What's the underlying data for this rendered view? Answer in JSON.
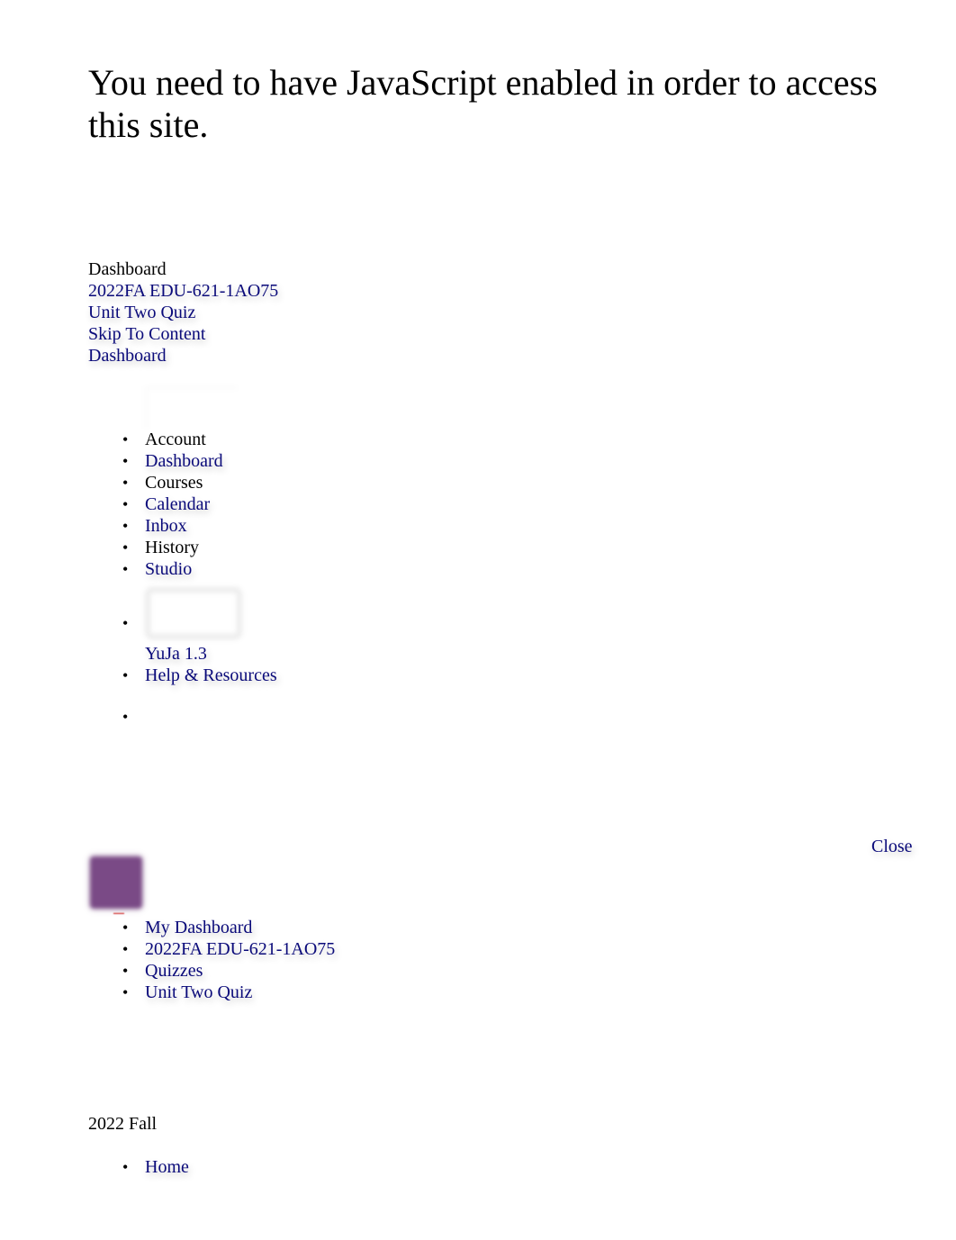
{
  "noscript_message": "You need to have JavaScript enabled in order to access this site.",
  "top_links": {
    "dashboard_text": "Dashboard",
    "course_link": "2022FA EDU-621-1AO75",
    "quiz_link": "Unit Two Quiz",
    "skip_link": "Skip To Content",
    "dashboard_link": "Dashboard"
  },
  "global_nav": {
    "items": [
      {
        "label": "Account",
        "is_link": false,
        "icon": "account-avatar-icon"
      },
      {
        "label": "Dashboard",
        "is_link": true
      },
      {
        "label": "Courses",
        "is_link": false
      },
      {
        "label": "Calendar",
        "is_link": true
      },
      {
        "label": "Inbox",
        "is_link": true
      },
      {
        "label": "History",
        "is_link": false
      },
      {
        "label": "Studio",
        "is_link": true
      },
      {
        "label": "YuJa 1.3",
        "is_link": true,
        "icon": "yuja-icon"
      },
      {
        "label": "Help & Resources",
        "is_link": true
      },
      {
        "label": "",
        "is_link": false
      }
    ]
  },
  "mobile_header": {
    "close_label": "Close",
    "logo_color": "#7a4a86",
    "logo_caption_color": "#d03030"
  },
  "breadcrumbs": [
    "My Dashboard",
    "2022FA EDU-621-1AO75",
    "Quizzes",
    "Unit Two Quiz"
  ],
  "course_nav": {
    "term": "2022 Fall",
    "items": [
      "Home"
    ]
  },
  "colors": {
    "link": "#0a0a7a",
    "text": "#000000",
    "background": "#ffffff"
  }
}
